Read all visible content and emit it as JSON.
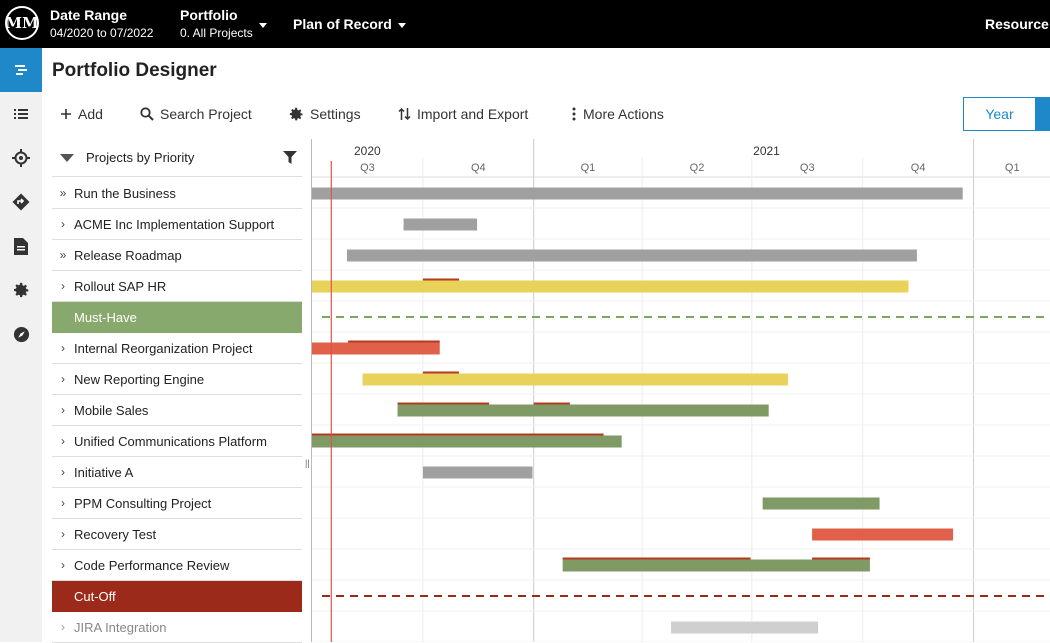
{
  "topbar": {
    "logo_text": "MM",
    "date_range": {
      "title": "Date Range",
      "value": "04/2020 to 07/2022"
    },
    "portfolio": {
      "title": "Portfolio",
      "value": "0. All Projects"
    },
    "plan": "Plan of Record",
    "resource": "Resource"
  },
  "leftnav": {
    "items": [
      {
        "icon": "gantt-icon",
        "active": true
      },
      {
        "icon": "list-icon"
      },
      {
        "icon": "target-icon"
      },
      {
        "icon": "roadmap-icon"
      },
      {
        "icon": "document-icon"
      },
      {
        "icon": "gear-icon"
      },
      {
        "icon": "compass-icon"
      }
    ]
  },
  "page": {
    "title": "Portfolio Designer"
  },
  "toolbar": {
    "add": "Add",
    "search": "Search Project",
    "settings": "Settings",
    "import_export": "Import and Export",
    "more": "More Actions",
    "year": "Year"
  },
  "list": {
    "header": "Projects by Priority",
    "rows": [
      {
        "label": "Run the Business",
        "chevron": "»"
      },
      {
        "label": "ACME Inc Implementation Support",
        "chevron": "›"
      },
      {
        "label": "Release Roadmap",
        "chevron": "»"
      },
      {
        "label": "Rollout SAP HR",
        "chevron": "›"
      },
      {
        "label": "Must-Have",
        "type": "must"
      },
      {
        "label": "Internal Reorganization Project",
        "chevron": "›"
      },
      {
        "label": "New Reporting Engine",
        "chevron": "›"
      },
      {
        "label": "Mobile Sales",
        "chevron": "›"
      },
      {
        "label": "Unified Communications Platform",
        "chevron": "›"
      },
      {
        "label": "Initiative A",
        "chevron": "›"
      },
      {
        "label": "PPM Consulting Project",
        "chevron": "›"
      },
      {
        "label": "Recovery Test",
        "chevron": "›"
      },
      {
        "label": "Code Performance Review",
        "chevron": "›"
      },
      {
        "label": "Cut-Off",
        "type": "cutoff"
      },
      {
        "label": "JIRA Integration",
        "chevron": "›",
        "faded": true
      }
    ]
  },
  "timeline": {
    "start": "2020-07-01",
    "end": "2022-01-15",
    "years": [
      {
        "label": "2020",
        "date": "2020-07-01"
      },
      {
        "label": "2021",
        "date": "2021-04-01"
      }
    ],
    "quarters": [
      {
        "label": "Q3",
        "start": "2020-07-01"
      },
      {
        "label": "Q4",
        "start": "2020-10-01"
      },
      {
        "label": "Q1",
        "start": "2021-01-01"
      },
      {
        "label": "Q2",
        "start": "2021-04-01"
      },
      {
        "label": "Q3",
        "start": "2021-07-01"
      },
      {
        "label": "Q4",
        "start": "2021-10-01"
      },
      {
        "label": "Q1",
        "start": "2022-01-01"
      }
    ],
    "today": "2020-07-17",
    "colors": {
      "gray": "#a0a0a0",
      "yellow": "#e8d25a",
      "red": "#e0604a",
      "green": "#7f9a64",
      "lightgray": "#cfcfcf",
      "marker": "#b53a1e",
      "must_line": "#7aa85f",
      "cutoff_line": "#9c2a1b",
      "today_line": "#d9534f"
    },
    "bars": [
      {
        "row": 0,
        "start": "2020-07-01",
        "end": "2021-12-23",
        "color": "gray"
      },
      {
        "row": 1,
        "start": "2020-09-15",
        "end": "2020-11-15",
        "color": "gray"
      },
      {
        "row": 2,
        "start": "2020-07-30",
        "end": "2021-11-15",
        "color": "gray"
      },
      {
        "row": 3,
        "start": "2020-07-01",
        "end": "2021-11-08",
        "color": "yellow",
        "markers": [
          [
            "2020-10-01",
            "2020-10-31"
          ]
        ]
      },
      {
        "row": 5,
        "start": "2020-07-01",
        "end": "2020-10-15",
        "color": "red",
        "markers": [
          [
            "2020-07-31",
            "2020-10-15"
          ]
        ]
      },
      {
        "row": 6,
        "start": "2020-08-12",
        "end": "2021-07-31",
        "color": "yellow",
        "markers": [
          [
            "2020-10-01",
            "2020-10-31"
          ]
        ]
      },
      {
        "row": 7,
        "start": "2020-09-10",
        "end": "2021-07-15",
        "color": "green",
        "markers": [
          [
            "2020-09-10",
            "2020-11-25"
          ],
          [
            "2021-01-01",
            "2021-01-31"
          ]
        ]
      },
      {
        "row": 8,
        "start": "2020-07-01",
        "end": "2021-03-15",
        "color": "green",
        "markers": [
          [
            "2020-07-01",
            "2021-02-28"
          ]
        ]
      },
      {
        "row": 9,
        "start": "2020-10-01",
        "end": "2020-12-31",
        "color": "gray"
      },
      {
        "row": 10,
        "start": "2021-07-10",
        "end": "2021-10-15",
        "color": "green"
      },
      {
        "row": 11,
        "start": "2021-08-20",
        "end": "2021-12-15",
        "color": "red"
      },
      {
        "row": 12,
        "start": "2021-01-25",
        "end": "2021-10-07",
        "color": "green",
        "markers": [
          [
            "2021-01-25",
            "2021-06-30"
          ],
          [
            "2021-08-20",
            "2021-10-07"
          ]
        ]
      },
      {
        "row": 14,
        "start": "2021-04-25",
        "end": "2021-08-25",
        "color": "lightgray"
      }
    ],
    "divider_lines": [
      {
        "row": 4,
        "color": "must_line"
      },
      {
        "row": 13,
        "color": "cutoff_line"
      }
    ]
  }
}
